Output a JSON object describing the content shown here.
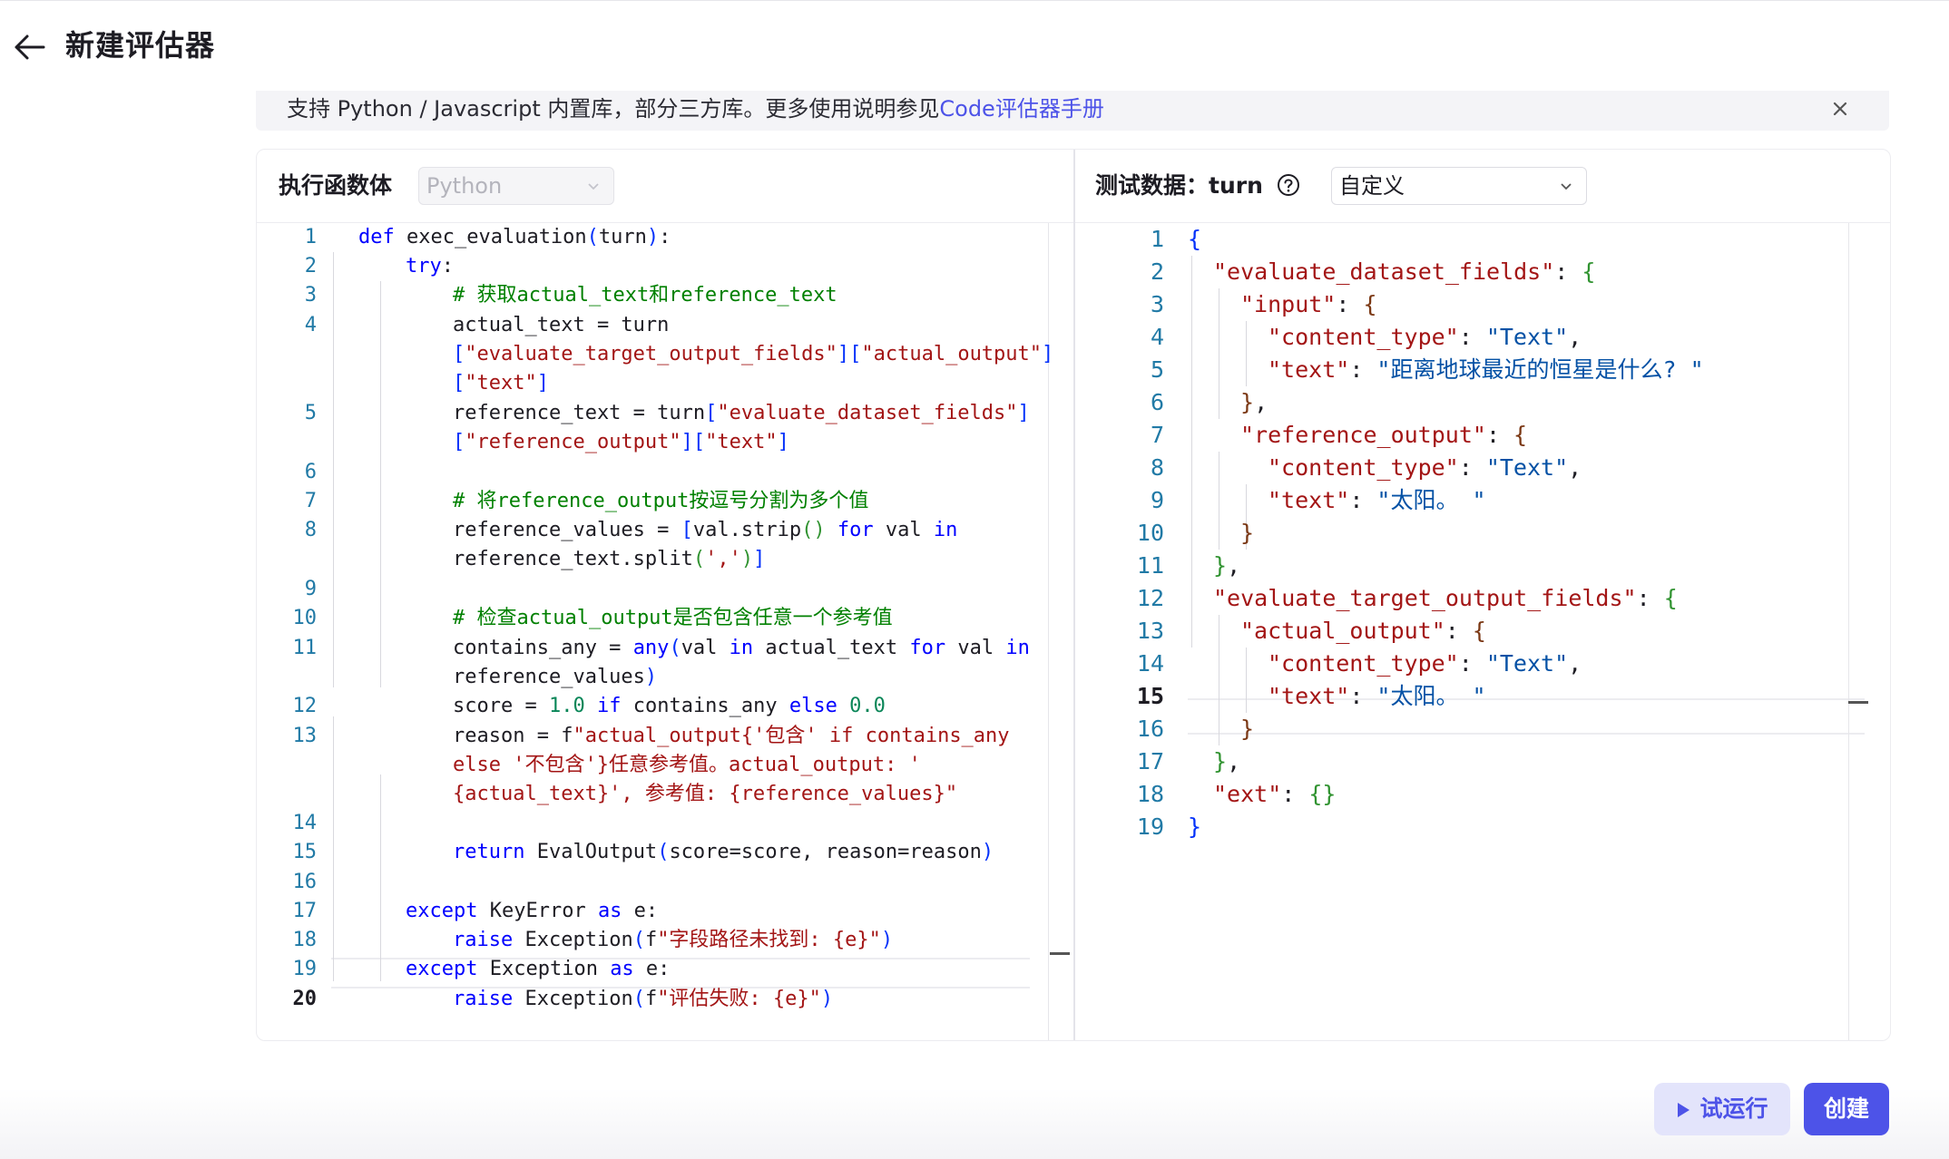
{
  "header": {
    "title": "新建评估器"
  },
  "banner": {
    "text": "支持 Python / Javascript 内置库，部分三方库。更多使用说明参见",
    "link_text": "Code评估器手册"
  },
  "left_panel": {
    "label": "执行函数体",
    "language_select": {
      "value": "Python",
      "disabled": true
    }
  },
  "right_panel": {
    "label": "测试数据：turn",
    "data_select": {
      "value": "自定义"
    }
  },
  "code_editor": {
    "active_line": 20,
    "lines": [
      {
        "n": "1",
        "text": "def exec_evaluation(turn):"
      },
      {
        "n": "2",
        "text": "try:"
      },
      {
        "n": "3",
        "text": "# 获取actual_text和reference_text"
      },
      {
        "n": "4",
        "text": "actual_text = turn [\"evaluate_target_output_fields\"][\"actual_output\"][\"text\"]"
      },
      {
        "n": "5",
        "text": "reference_text = turn[\"evaluate_dataset_fields\"][\"reference_output\"][\"text\"]"
      },
      {
        "n": "6",
        "text": ""
      },
      {
        "n": "7",
        "text": "# 将reference_output按逗号分割为多个值"
      },
      {
        "n": "8",
        "text": "reference_values = [val.strip() for val in reference_text.split(',')]"
      },
      {
        "n": "9",
        "text": ""
      },
      {
        "n": "10",
        "text": "# 检查actual_output是否包含任意一个参考值"
      },
      {
        "n": "11",
        "text": "contains_any = any(val in actual_text for val in reference_values)"
      },
      {
        "n": "12",
        "text": "score = 1.0 if contains_any else 0.0"
      },
      {
        "n": "13",
        "text": "reason = f\"actual_output{'包含' if contains_any else '不包含'}任意参考值。actual_output: '{actual_text}', 参考值: {reference_values}\""
      },
      {
        "n": "14",
        "text": ""
      },
      {
        "n": "15",
        "text": "return EvalOutput(score=score, reason=reason)"
      },
      {
        "n": "16",
        "text": ""
      },
      {
        "n": "17",
        "text": "except KeyError as e:"
      },
      {
        "n": "18",
        "text": "raise Exception(f\"字段路径未找到: {e}\")"
      },
      {
        "n": "19",
        "text": "except Exception as e:"
      },
      {
        "n": "20",
        "text": "raise Exception(f\"评估失败: {e}\")"
      }
    ]
  },
  "json_editor": {
    "active_line": 15,
    "lines": [
      {
        "n": "1",
        "text": "{"
      },
      {
        "n": "2",
        "text": "\"evaluate_dataset_fields\": {"
      },
      {
        "n": "3",
        "text": "\"input\": {"
      },
      {
        "n": "4",
        "text": "\"content_type\": \"Text\","
      },
      {
        "n": "5",
        "text": "\"text\": \"距离地球最近的恒星是什么? \""
      },
      {
        "n": "6",
        "text": "},"
      },
      {
        "n": "7",
        "text": "\"reference_output\": {"
      },
      {
        "n": "8",
        "text": "\"content_type\": \"Text\","
      },
      {
        "n": "9",
        "text": "\"text\": \"太阳。 \""
      },
      {
        "n": "10",
        "text": "}"
      },
      {
        "n": "11",
        "text": "},"
      },
      {
        "n": "12",
        "text": "\"evaluate_target_output_fields\": {"
      },
      {
        "n": "13",
        "text": "\"actual_output\": {"
      },
      {
        "n": "14",
        "text": "\"content_type\": \"Text\","
      },
      {
        "n": "15",
        "text": "\"text\": \"太阳。 \""
      },
      {
        "n": "16",
        "text": "}"
      },
      {
        "n": "17",
        "text": "},"
      },
      {
        "n": "18",
        "text": "\"ext\": {}"
      },
      {
        "n": "19",
        "text": "}"
      }
    ]
  },
  "footer": {
    "try_run_label": "试运行",
    "create_label": "创建"
  },
  "colors": {
    "accent": "#4d53e8",
    "keyword": "#0000ff",
    "string": "#a31515",
    "comment": "#008000",
    "number": "#098658",
    "line_number": "#217aa6"
  },
  "icons": [
    "arrow-left-icon",
    "close-icon",
    "chevron-down-icon",
    "question-circle-icon",
    "play-icon"
  ]
}
